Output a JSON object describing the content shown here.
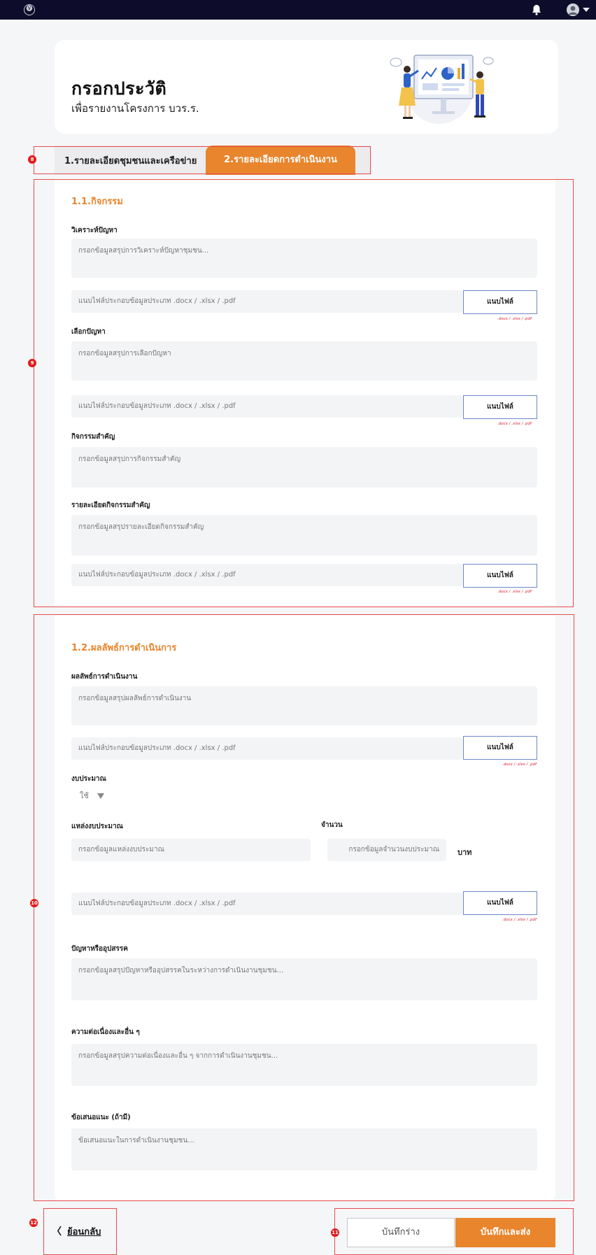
{
  "header": {
    "logo_glyph": "🅥",
    "icons": [
      "bell-icon",
      "avatar-icon",
      "chevron-down-icon"
    ]
  },
  "hero": {
    "title": "กรอกประวัติ",
    "subtitle": "เพื่อรายงานโครงการ บวร.ร."
  },
  "tabs": [
    {
      "label": "1.รายละเอียดชุมชนและเครือข่าย",
      "active": false
    },
    {
      "label": "2.รายละเอียดการดำเนินงาน",
      "active": true
    }
  ],
  "section1": {
    "title": "1.1.กิจกรรม",
    "analysis": {
      "label": "วิเคราะห์ปัญหา",
      "placeholder": "กรอกข้อมูลสรุปการวิเคราะห์ปัญหาชุมชน..."
    },
    "choose": {
      "label": "เลือกปัญหา",
      "placeholder": "กรอกข้อมูลสรุปการเลือกปัญหา"
    },
    "key_activity": {
      "label": "กิจกรรมสำคัญ",
      "placeholder": "กรอกข้อมูลสรุปการกิจกรรมสำคัญ"
    },
    "key_detail": {
      "label": "รายละเอียดกิจกรรมสำคัญ",
      "placeholder": "กรอกข้อมูลสรุปรายละเอียดกิจกรรมสำคัญ"
    }
  },
  "section2": {
    "title": "1.2.ผลลัพธ์การดำเนินการ",
    "result": {
      "label": "ผลลัพธ์การดำเนินงาน",
      "placeholder": "กรอกข้อมูลสรุปผลลัพธ์การดำเนินงาน"
    },
    "budget": {
      "label": "งบประมาณ",
      "selected": "ใช้"
    },
    "budget_source": {
      "label": "แหล่งงบประมาณ",
      "placeholder": "กรอกข้อมูลแหล่งงบประมาณ"
    },
    "amount": {
      "label": "จำนวน",
      "placeholder": "กรอกข้อมูลจำนวนงบประมาณ",
      "unit": "บาท"
    },
    "problems": {
      "label": "ปัญหาหรืออุปสรรค",
      "placeholder": "กรอกข้อมูลสรุปปัญหาหรืออุปสรรคในระหว่างการดำเนินงานชุมชน..."
    },
    "continuity": {
      "label": "ความต่อเนื่องและอื่น ๆ",
      "placeholder": "กรอกข้อมูลสรุปความต่อเนื่องและอื่น ๆ จากการดำเนินงานชุมชน..."
    },
    "suggestion": {
      "label": "ข้อเสนอแนะ (ถ้ามี)",
      "placeholder": "ข้อเสนอแนะในการดำเนินงานชุมชน..."
    }
  },
  "file": {
    "placeholder": "แนบไฟล์ประกอบข้อมูลประเภท  .docx / .xlsx / .pdf",
    "button": "แนบไฟล์",
    "hint1": ".docx / .xlsx / .pdf",
    "hint2": ".docx / .xlsx / .pdf"
  },
  "footer": {
    "back": "ย้อนกลับ",
    "back_glyph": "〈",
    "draft": "บันทึกร่าง",
    "submit": "บันทึกและส่ง"
  },
  "annotations": [
    "8",
    "9",
    "10",
    "11",
    "12"
  ],
  "colors": {
    "accent": "#e8852d",
    "topbar": "#0d0d2b",
    "annotation": "#e21b1b"
  }
}
